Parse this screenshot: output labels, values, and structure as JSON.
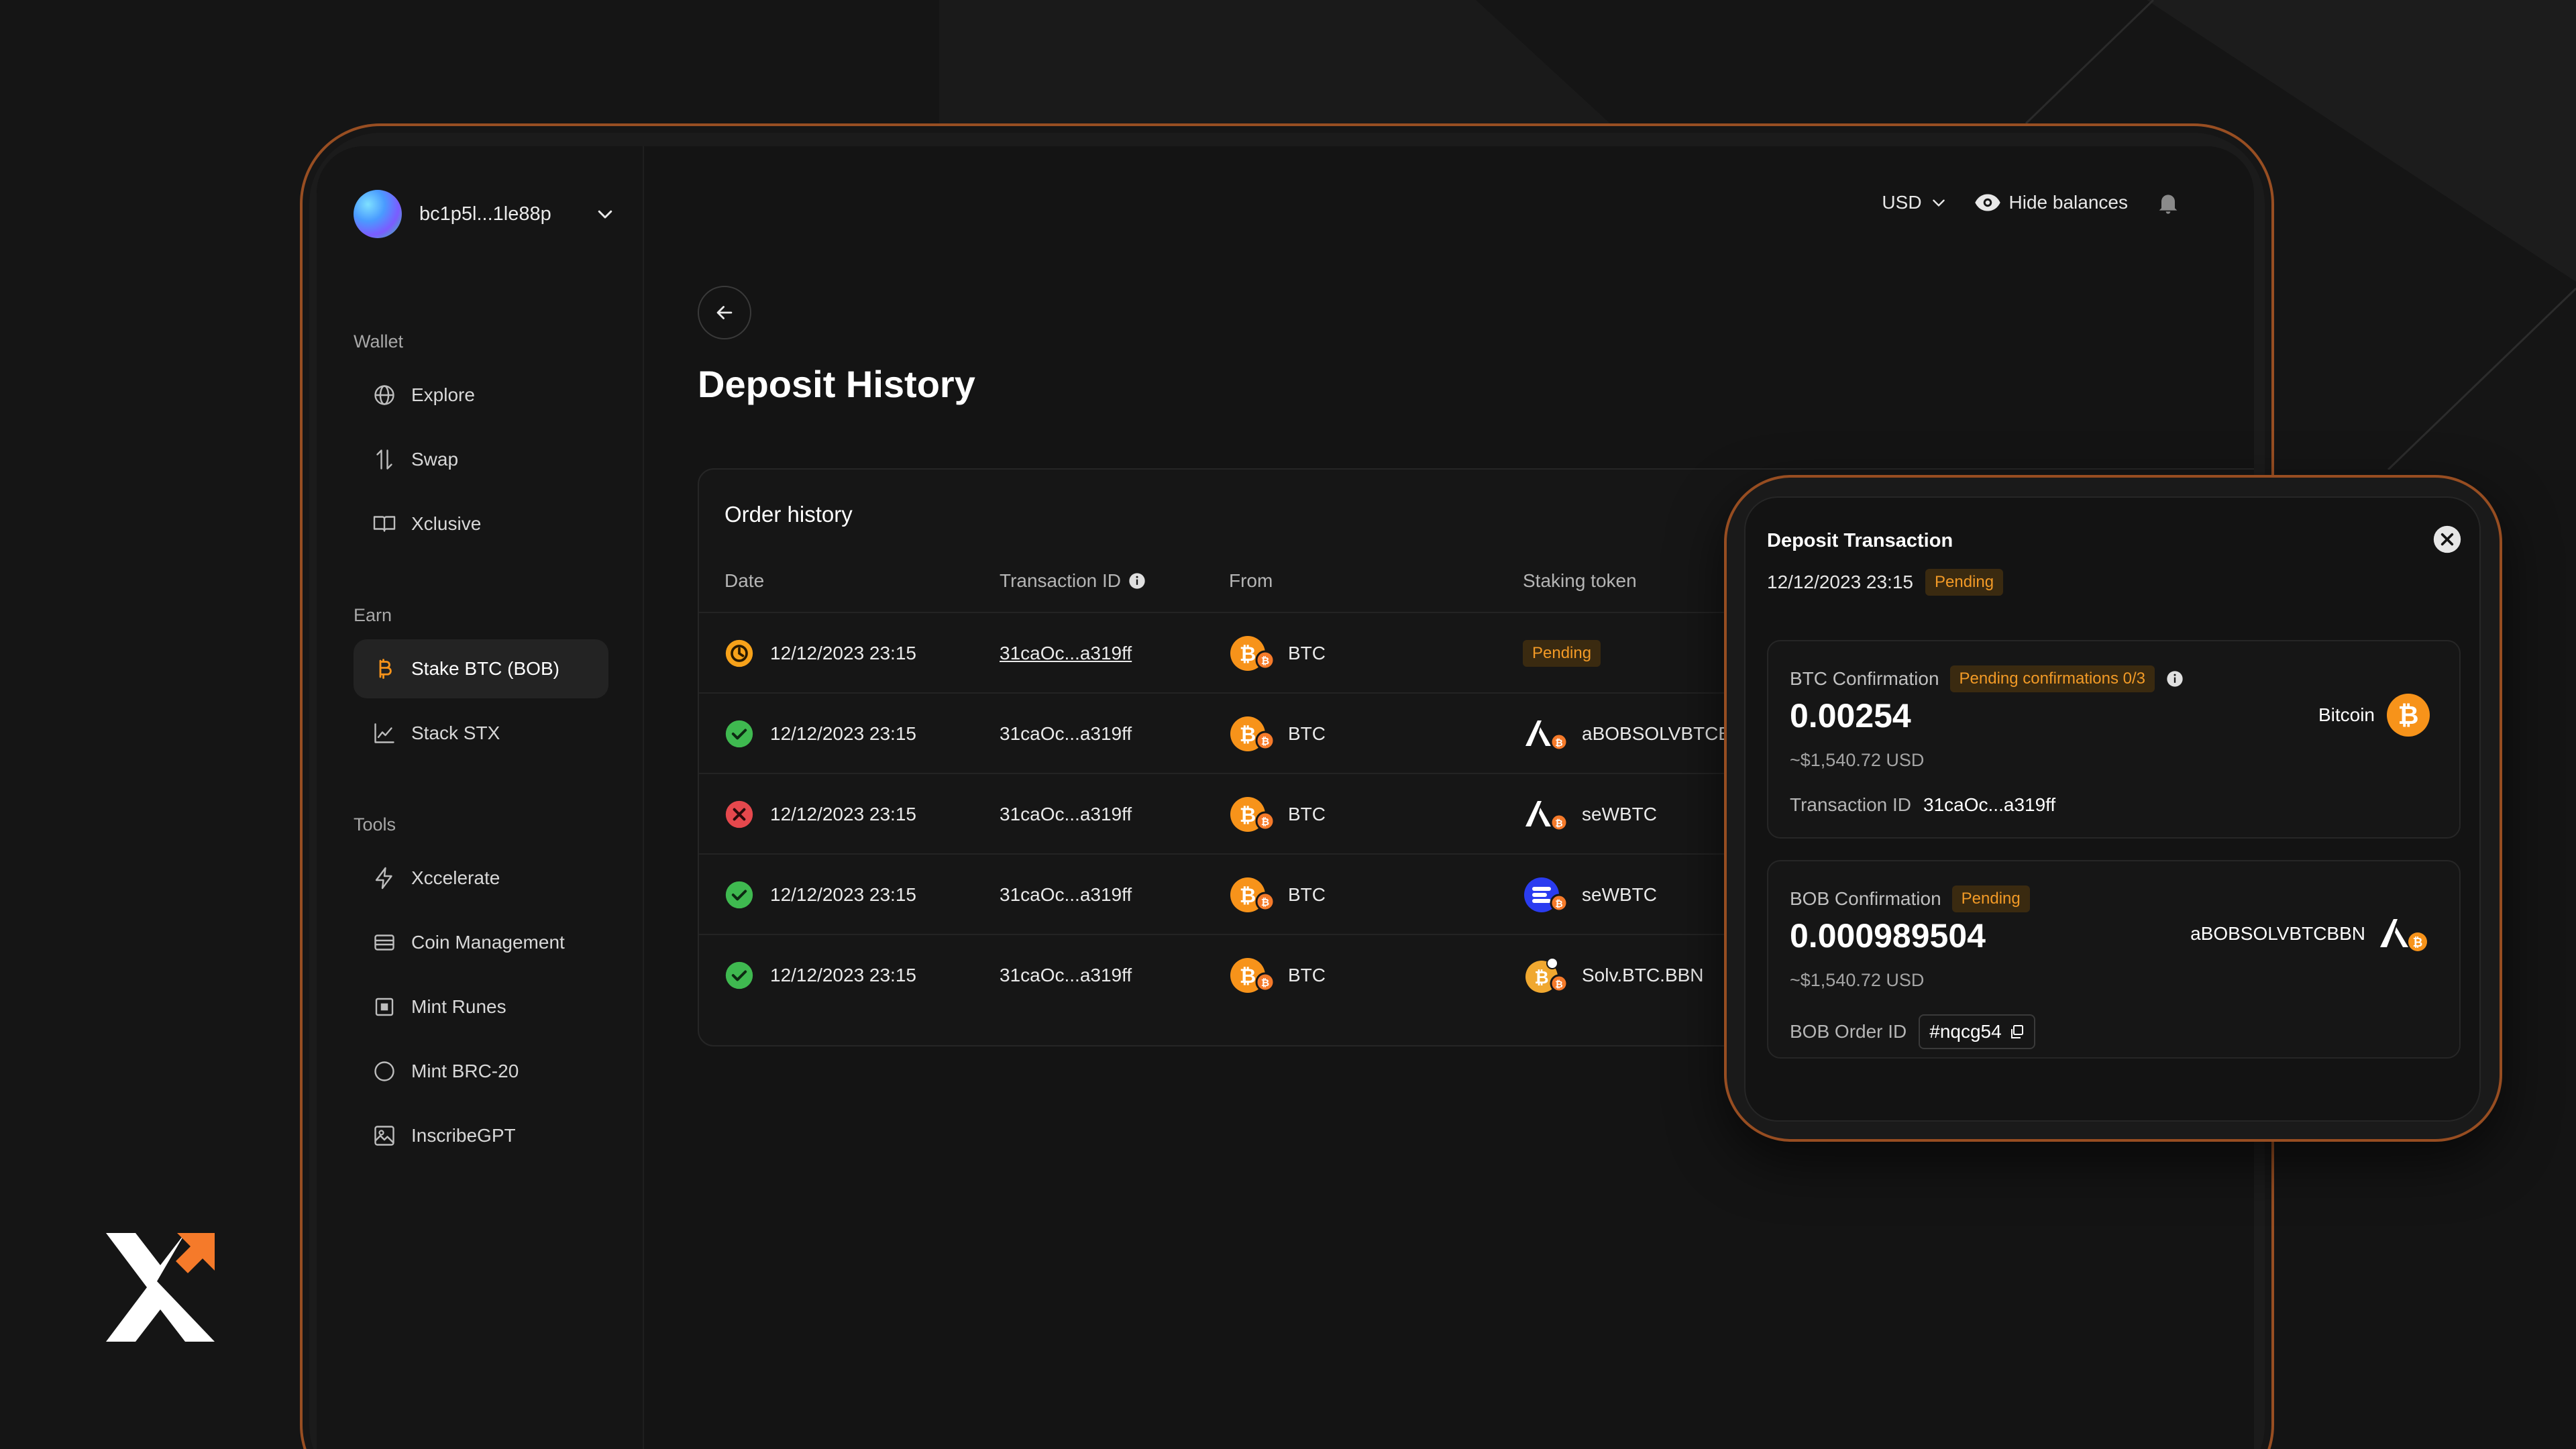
{
  "account": {
    "address": "bc1p5l...1le88p"
  },
  "sidebar": {
    "sections": [
      {
        "label": "Wallet",
        "items": [
          {
            "label": "Explore",
            "icon": "globe-icon"
          },
          {
            "label": "Swap",
            "icon": "swap-icon"
          },
          {
            "label": "Xclusive",
            "icon": "book-icon"
          }
        ]
      },
      {
        "label": "Earn",
        "items": [
          {
            "label": "Stake BTC (BOB)",
            "icon": "bitcoin-icon",
            "active": true
          },
          {
            "label": "Stack STX",
            "icon": "chart-icon"
          }
        ]
      },
      {
        "label": "Tools",
        "items": [
          {
            "label": "Xccelerate",
            "icon": "bolt-icon"
          },
          {
            "label": "Coin Management",
            "icon": "wallet-icon"
          },
          {
            "label": "Mint Runes",
            "icon": "square-icon"
          },
          {
            "label": "Mint BRC-20",
            "icon": "circle-icon"
          },
          {
            "label": "InscribeGPT",
            "icon": "image-icon"
          }
        ]
      }
    ]
  },
  "topbar": {
    "currency": "USD",
    "hide_balances": "Hide balances"
  },
  "page": {
    "title": "Deposit History"
  },
  "orders": {
    "title": "Order history",
    "columns": {
      "date": "Date",
      "txid": "Transaction ID",
      "from": "From",
      "staking": "Staking token"
    },
    "rows": [
      {
        "status": "pending",
        "date": "12/12/2023 23:15",
        "txid": "31caOc...a319ff",
        "from": "BTC",
        "token": "",
        "token_badge": "Pending",
        "token_icon": ""
      },
      {
        "status": "success",
        "date": "12/12/2023 23:15",
        "txid": "31caOc...a319ff",
        "from": "BTC",
        "token": "aBOBSOLVBTCBBN",
        "token_badge": "",
        "token_icon": "avalon"
      },
      {
        "status": "failed",
        "date": "12/12/2023 23:15",
        "txid": "31caOc...a319ff",
        "from": "BTC",
        "token": "seWBTC",
        "token_badge": "",
        "token_icon": "avalon"
      },
      {
        "status": "success",
        "date": "12/12/2023 23:15",
        "txid": "31caOc...a319ff",
        "from": "BTC",
        "token": "seWBTC",
        "token_badge": "",
        "token_icon": "segment"
      },
      {
        "status": "success",
        "date": "12/12/2023 23:15",
        "txid": "31caOc...a319ff",
        "from": "BTC",
        "token": "Solv.BTC.BBN",
        "token_badge": "",
        "token_icon": "solv"
      }
    ]
  },
  "popup": {
    "title": "Deposit Transaction",
    "date": "12/12/2023 23:15",
    "status": "Pending",
    "btc": {
      "label": "BTC Confirmation",
      "badge": "Pending confirmations 0/3",
      "amount": "0.00254",
      "usd": "~$1,540.72 USD",
      "asset": "Bitcoin",
      "foot_label": "Transaction ID",
      "foot_value": "31caOc...a319ff"
    },
    "bob": {
      "label": "BOB Confirmation",
      "badge": "Pending",
      "amount": "0.000989504",
      "usd": "~$1,540.72 USD",
      "asset": "aBOBSOLVBTCBBN",
      "foot_label": "BOB Order ID",
      "foot_value": "#nqcg54"
    }
  },
  "colors": {
    "accent": "#f7931a",
    "success": "#3fb950",
    "error": "#e5484d",
    "pending_bg": "#3a2a10",
    "pending_fg": "#f29a26"
  }
}
